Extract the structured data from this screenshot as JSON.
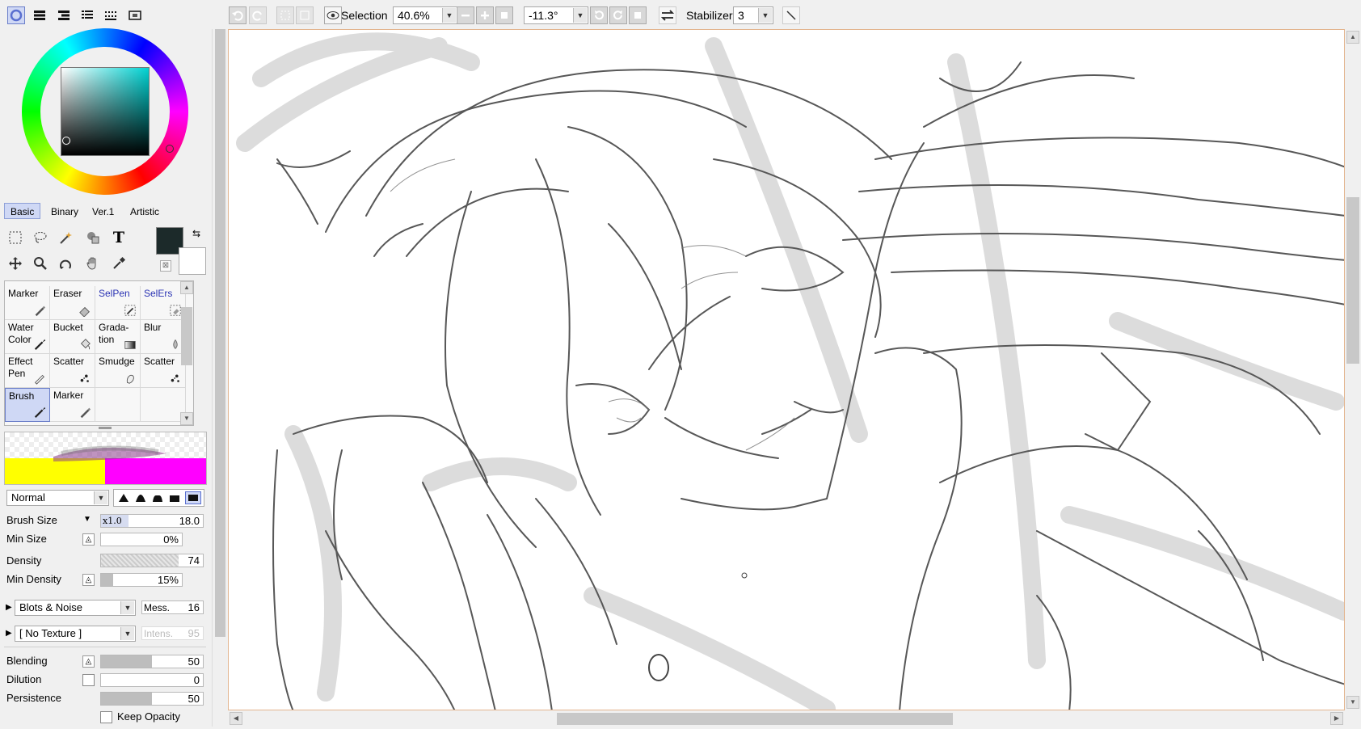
{
  "panel_tabs": [
    "color-wheel",
    "color-sliders",
    "color-list",
    "swatches",
    "scratchpad",
    "navigator"
  ],
  "color": {
    "hue": "#00d2d2",
    "primary": "#1c2a2a",
    "secondary": "#ffffff"
  },
  "preset_tabs": [
    {
      "label": "Basic",
      "active": true
    },
    {
      "label": "Binary",
      "active": false
    },
    {
      "label": "Ver.1",
      "active": false
    },
    {
      "label": "Artistic",
      "active": false
    }
  ],
  "tools": {
    "text_glyph": "T"
  },
  "brushes": [
    {
      "label": "Marker",
      "icon": "marker-icon",
      "blue": false,
      "selected": false
    },
    {
      "label": "Eraser",
      "icon": "eraser-icon",
      "blue": false,
      "selected": false
    },
    {
      "label": "SelPen",
      "icon": "selpen-icon",
      "blue": true,
      "selected": false
    },
    {
      "label": "SelErs",
      "icon": "selers-icon",
      "blue": true,
      "selected": false
    },
    {
      "label": "Water\nColor",
      "icon": "watercolor-icon",
      "blue": false,
      "selected": false
    },
    {
      "label": "Bucket",
      "icon": "bucket-icon",
      "blue": false,
      "selected": false
    },
    {
      "label": "Grada-\ntion",
      "icon": "gradation-icon",
      "blue": false,
      "selected": false
    },
    {
      "label": "Blur",
      "icon": "blur-icon",
      "blue": false,
      "selected": false
    },
    {
      "label": "Effect\nPen",
      "icon": "effect-pen-icon",
      "blue": false,
      "selected": false
    },
    {
      "label": "Scatter",
      "icon": "scatter-icon",
      "blue": false,
      "selected": false
    },
    {
      "label": "Smudge",
      "icon": "smudge-icon",
      "blue": false,
      "selected": false
    },
    {
      "label": "Scatter",
      "icon": "scatter-icon",
      "blue": false,
      "selected": false
    },
    {
      "label": "Brush",
      "icon": "brush-icon",
      "blue": false,
      "selected": true
    },
    {
      "label": "Marker",
      "icon": "marker-icon",
      "blue": false,
      "selected": false
    }
  ],
  "blend_mode": "Normal",
  "params": {
    "brush_size_label": "Brush Size",
    "brush_size_mult": "x1.0",
    "brush_size": "18.0",
    "min_size_label": "Min Size",
    "min_size": "0%",
    "min_size_fraction": 0,
    "density_label": "Density",
    "density": "74",
    "min_density_label": "Min Density",
    "min_density": "15%",
    "min_density_fraction": 0.15,
    "blots_label": "Blots & Noise",
    "mess_label": "Mess.",
    "mess": "16",
    "texture_label": "[ No Texture ]",
    "intens_label": "Intens.",
    "intens": "95",
    "blending_label": "Blending",
    "blending": "50",
    "blending_fraction": 0.5,
    "dilution_label": "Dilution",
    "dilution": "0",
    "persistence_label": "Persistence",
    "persistence": "50",
    "persistence_fraction": 0.5,
    "keep_opacity_label": "Keep Opacity"
  },
  "toolbar": {
    "selection_label": "Selection",
    "zoom": "40.6%",
    "rotation": "-11.3°",
    "stabilizer_label": "Stabilizer",
    "stabilizer": "3"
  }
}
